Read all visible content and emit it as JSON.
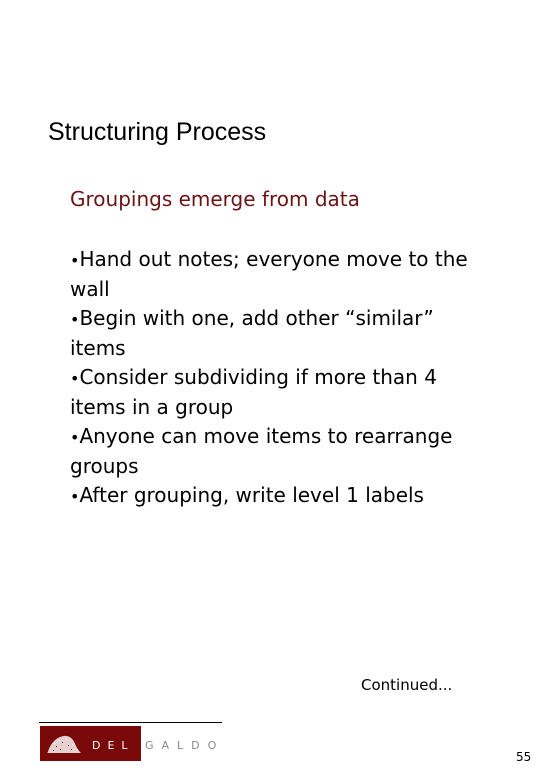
{
  "slide": {
    "title": "Structuring Process",
    "subtitle": "Groupings emerge from data",
    "subtitle_color": "#6b1414",
    "bullet_glyph": "•",
    "bullets": [
      "Hand out notes; everyone move to the wall",
      "Begin with one, add other “similar” items",
      "Consider subdividing if more than 4 items in a group",
      "Anyone can move items to rearrange groups",
      "After grouping, write level 1 labels"
    ],
    "continued": "Continued...",
    "page_number": "55"
  },
  "logo": {
    "letters_in_block": "DEL",
    "letters_outside": "GALDO",
    "block_color": "#7a0a0a",
    "outside_text_color": "#8a8a8a"
  }
}
